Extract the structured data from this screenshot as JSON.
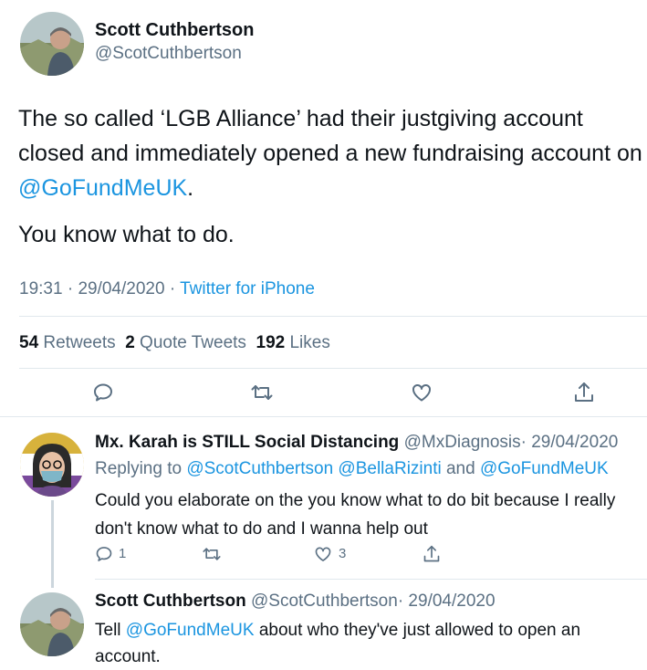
{
  "main_tweet": {
    "author_name": "Scott Cuthbertson",
    "author_handle": "@ScotCuthbertson",
    "text_part1": "The so called ‘LGB Alliance’ had their justgiving account closed and immediately opened a new fundraising account on ",
    "text_mention": "@GoFundMeUK",
    "text_part2": ".",
    "text_line2": "You know what to do.",
    "time": "19:31",
    "date": "29/04/2020",
    "sep": "·",
    "source": "Twitter for iPhone",
    "retweets_count": "54",
    "retweets_label": "Retweets",
    "quotes_count": "2",
    "quotes_label": "Quote Tweets",
    "likes_count": "192",
    "likes_label": "Likes"
  },
  "reply1": {
    "author_name": "Mx. Karah is STILL Social Distancing",
    "author_handle": "@MxDiagnosis",
    "date": "· 29/04/2020",
    "replying_prefix": "Replying to",
    "replying_users": "@ScotCuthbertson @BellaRizinti",
    "replying_and": "and",
    "replying_last": "@GoFundMeUK",
    "text": "Could you elaborate on the you know what to do bit because I really don't know what to do and I wanna help out",
    "reply_count": "1",
    "like_count": "3"
  },
  "reply2": {
    "author_name": "Scott Cuthbertson",
    "author_handle": "@ScotCuthbertson",
    "date": "· 29/04/2020",
    "text_prefix": "Tell",
    "text_mention": "@GoFundMeUK",
    "text_rest": "about who they've just allowed to open an account."
  },
  "icons": [
    "reply-icon",
    "retweet-icon",
    "like-icon",
    "share-icon"
  ],
  "colors": {
    "link": "#1b95e0",
    "secondary": "#5b7083",
    "divider": "#e1e8ed"
  }
}
